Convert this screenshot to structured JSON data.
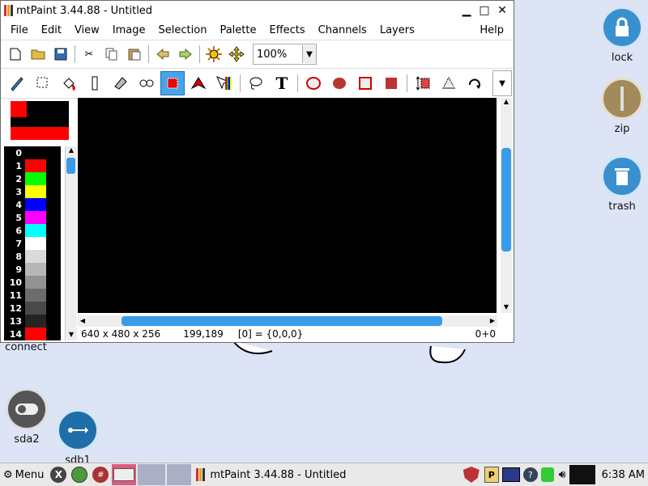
{
  "desktop": {
    "icons": [
      {
        "label": "lock",
        "icon": "lock-icon"
      },
      {
        "label": "zip",
        "icon": "zipper-icon"
      },
      {
        "label": "trash",
        "icon": "trash-icon"
      },
      {
        "label": "connect",
        "icon": "connect-icon"
      },
      {
        "label": "sda2",
        "icon": "toggle-drive-icon"
      },
      {
        "label": "sdb1",
        "icon": "usb-icon"
      }
    ]
  },
  "window": {
    "title": "mtPaint 3.44.88 - Untitled",
    "menu": [
      "File",
      "Edit",
      "View",
      "Image",
      "Selection",
      "Palette",
      "Effects",
      "Channels",
      "Layers",
      "Help"
    ],
    "zoom": "100%",
    "status": {
      "dims": "640 x 480 x 256",
      "coords": "199,189",
      "pixel": "[0] = {0,0,0}",
      "sel": "0+0"
    },
    "palette": [
      {
        "n": "0",
        "c": "#000000"
      },
      {
        "n": "1",
        "c": "#ff0000"
      },
      {
        "n": "2",
        "c": "#00ff00"
      },
      {
        "n": "3",
        "c": "#ffff00"
      },
      {
        "n": "4",
        "c": "#0000ff"
      },
      {
        "n": "5",
        "c": "#ff00ff"
      },
      {
        "n": "6",
        "c": "#00ffff"
      },
      {
        "n": "7",
        "c": "#ffffff"
      },
      {
        "n": "8",
        "c": "#dadada"
      },
      {
        "n": "9",
        "c": "#b6b6b6"
      },
      {
        "n": "10",
        "c": "#929292"
      },
      {
        "n": "11",
        "c": "#6d6d6d"
      },
      {
        "n": "12",
        "c": "#494949"
      },
      {
        "n": "13",
        "c": "#242424"
      },
      {
        "n": "14",
        "c": "#ff0000"
      }
    ]
  },
  "taskbar": {
    "menu_label": "Menu",
    "app_label": "mtPaint 3.44.88 - Untitled",
    "clock": "6:38 AM"
  }
}
